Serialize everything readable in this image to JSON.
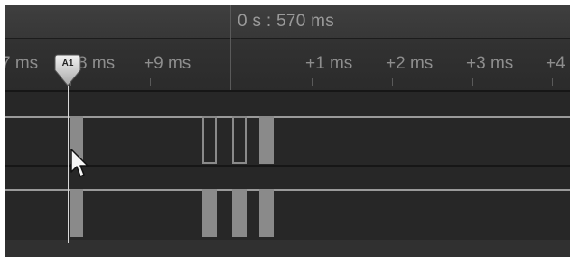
{
  "header": {
    "time_label": "0 s : 570 ms"
  },
  "ruler": {
    "ticks": [
      "7 ms",
      "8 ms",
      "+9 ms",
      "+1 ms",
      "+2 ms",
      "+3 ms",
      "+4"
    ]
  },
  "marker": {
    "label": "A1"
  },
  "icons": {
    "marker": "timing-marker-icon",
    "pointer": "mouse-pointer-icon"
  },
  "colors": {
    "background": "#2a2a2a",
    "signal": "#8a8a8a",
    "cursor_line": "#d8d8d8",
    "text": "#9a9a9a"
  }
}
